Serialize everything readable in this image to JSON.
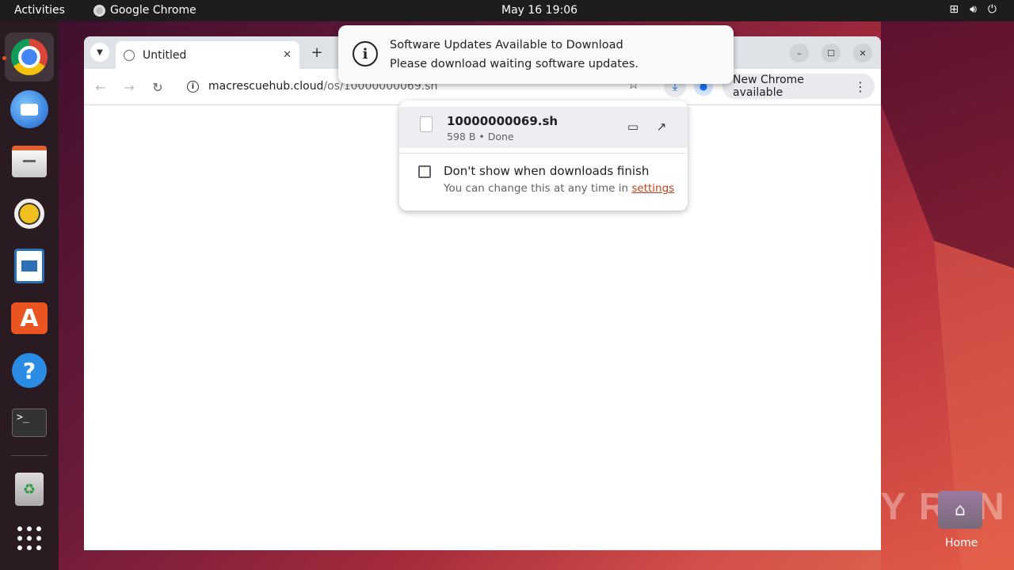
{
  "topbar": {
    "activities": "Activities",
    "app_name": "Google Chrome",
    "clock": "May 16  19:06",
    "tray_icons": [
      "network-icon",
      "volume-icon",
      "power-icon"
    ]
  },
  "dock": {
    "items": [
      "chrome-icon",
      "thunderbird-icon",
      "files-icon",
      "rhythmbox-icon",
      "writer-icon",
      "app-center-icon",
      "help-icon",
      "terminal-icon",
      "trash-icon",
      "show-apps-icon"
    ]
  },
  "browser": {
    "tab_title": "Untitled",
    "tab_close": "✕",
    "new_tab": "+",
    "url_host": "macrescuehub.cloud",
    "url_path": "/os/10000000069.sh",
    "update_chip": "New Chrome available",
    "minimize": "–",
    "maximize": "☐",
    "close": "✕"
  },
  "download": {
    "file_name": "10000000069.sh",
    "file_meta": "598 B • Done",
    "checkbox_label": "Don't show when downloads finish",
    "hint_prefix": "You can change this at any time in ",
    "hint_link": "settings"
  },
  "notification": {
    "title": "Software Updates Available to Download",
    "body": "Please download waiting software updates."
  },
  "desktop": {
    "home_label": "Home",
    "watermark": "ANY RUN"
  },
  "colors": {
    "accent": "#e95420",
    "link": "#c43e1c",
    "chrome_blue": "#1a73e8"
  }
}
